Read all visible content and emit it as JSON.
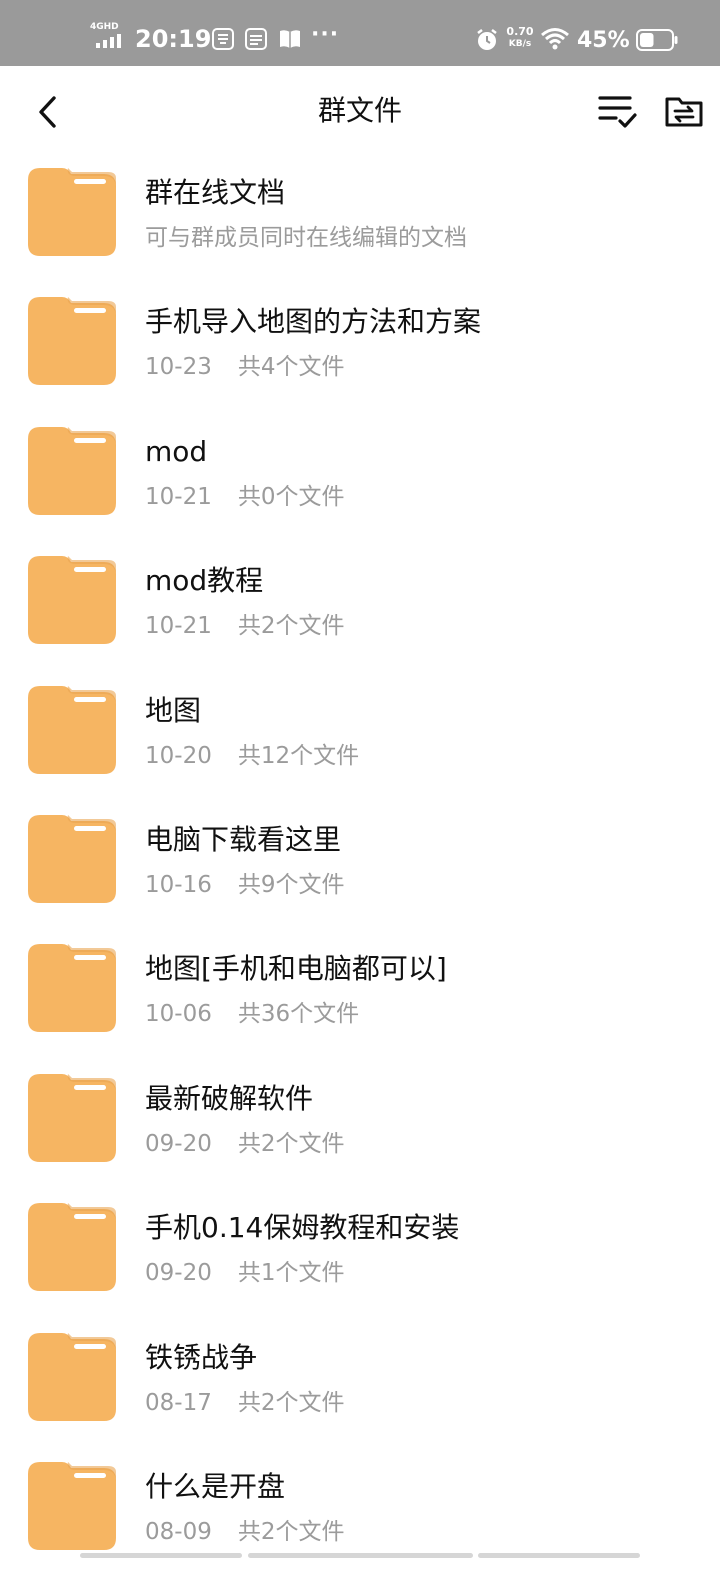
{
  "status_bar": {
    "network_type": "4GHD",
    "time": "20:19",
    "more": "···",
    "net_speed_value": "0.70",
    "net_speed_unit": "KB/s",
    "battery_percent": "45%",
    "battery_level": 0.45
  },
  "header": {
    "title": "群文件",
    "back_icon": "chevron-left-icon",
    "multi_select_icon": "list-check-icon",
    "folder_manage_icon": "folder-transfer-icon"
  },
  "colors": {
    "folder": "#F6B562",
    "folder_tab_stripe": "#FFFFFF",
    "meta_text": "#9B9B9B",
    "status_bar_bg": "#9A9A9A"
  },
  "items": [
    {
      "name": "群在线文档",
      "date": "可与群成员同时在线编辑的文档",
      "count": ""
    },
    {
      "name": "手机导入地图的方法和方案",
      "date": "10-23",
      "count": "共4个文件"
    },
    {
      "name": "mod",
      "date": "10-21",
      "count": "共0个文件"
    },
    {
      "name": "mod教程",
      "date": "10-21",
      "count": "共2个文件"
    },
    {
      "name": "地图",
      "date": "10-20",
      "count": "共12个文件"
    },
    {
      "name": "电脑下载看这里",
      "date": "10-16",
      "count": "共9个文件"
    },
    {
      "name": "地图[手机和电脑都可以]",
      "date": "10-06",
      "count": "共36个文件"
    },
    {
      "name": "最新破解软件",
      "date": "09-20",
      "count": "共2个文件"
    },
    {
      "name": "手机0.14保姆教程和安装",
      "date": "09-20",
      "count": "共1个文件"
    },
    {
      "name": "铁锈战争",
      "date": "08-17",
      "count": "共2个文件"
    },
    {
      "name": "什么是开盘",
      "date": "08-09",
      "count": "共2个文件"
    }
  ]
}
